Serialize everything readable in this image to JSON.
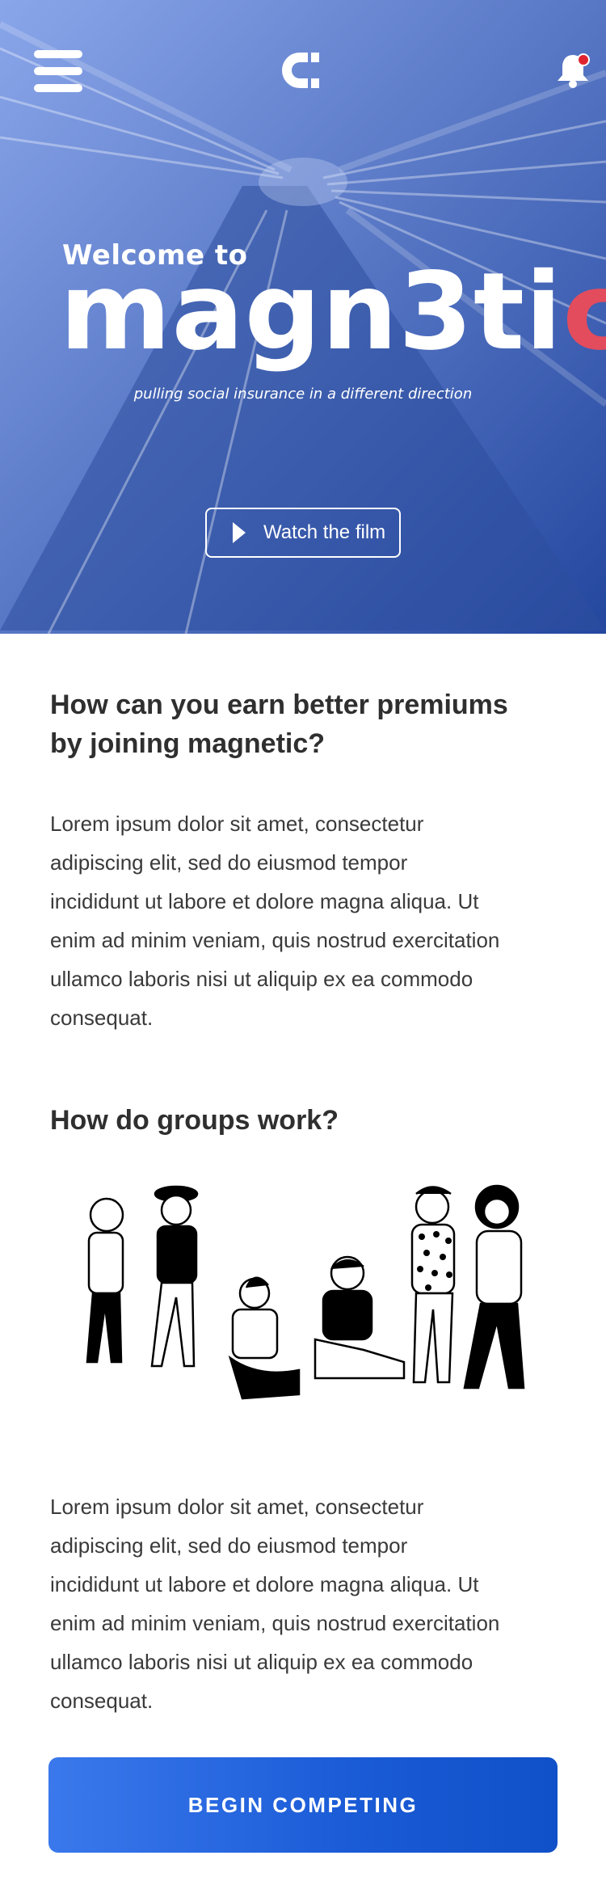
{
  "header": {
    "menu_icon": "hamburger-menu-icon",
    "logo_icon": "magnet-logo-icon",
    "notification_icon": "bell-icon",
    "notification_badge_color": "#e0242f"
  },
  "hero": {
    "welcome": "Welcome to",
    "brand_main": "magn3ti",
    "brand_accent": "c",
    "tagline": "pulling social insurance in a different direction",
    "film_button": "Watch the  film",
    "accent_color": "#e24c5d"
  },
  "section1": {
    "heading_line1": "How can you earn better premiums",
    "heading_line2": "by joining magnetic?",
    "body": [
      "Lorem ipsum dolor sit amet, consectetur",
      "adipiscing elit, sed do eiusmod tempor",
      "incididunt ut labore et dolore magna aliqua. Ut",
      "enim ad minim veniam, quis nostrud exercitation",
      "ullamco laboris nisi ut aliquip ex ea commodo",
      "consequat."
    ]
  },
  "section2": {
    "heading": "How do groups work?",
    "illustration": "group-of-people-illustration",
    "body": [
      "Lorem ipsum dolor sit amet, consectetur",
      "adipiscing elit, sed do eiusmod tempor",
      "incididunt ut labore et dolore magna aliqua. Ut",
      "enim ad minim veniam, quis nostrud exercitation",
      "ullamco laboris nisi ut aliquip ex ea commodo",
      "consequat."
    ]
  },
  "cta": {
    "label": "BEGIN COMPETING"
  }
}
